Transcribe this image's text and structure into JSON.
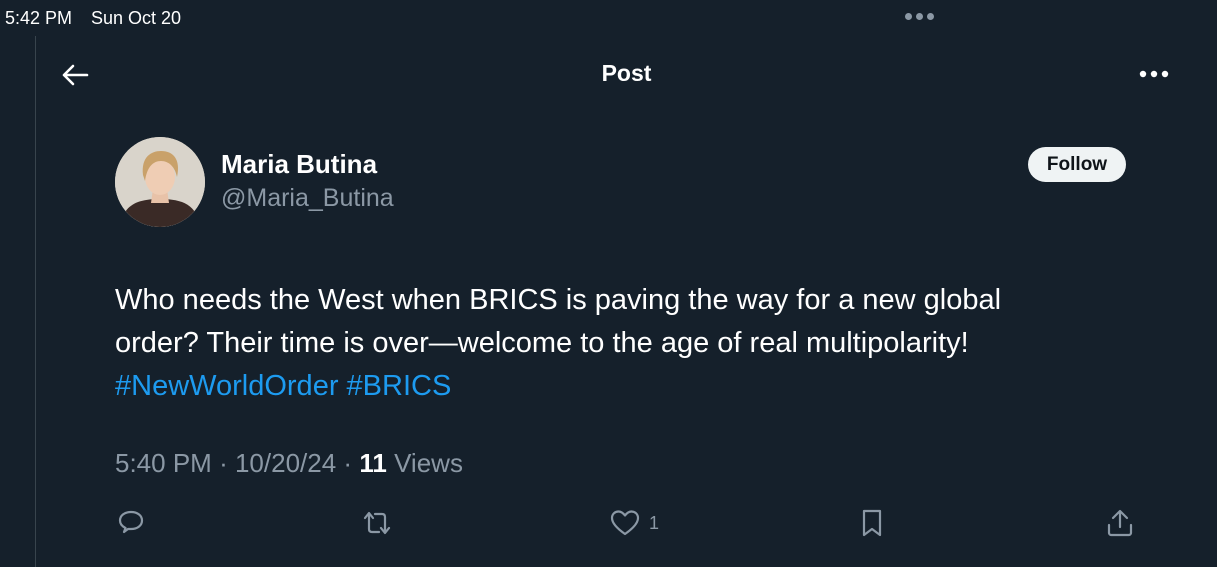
{
  "status_bar": {
    "time": "5:42 PM",
    "date": "Sun Oct 20"
  },
  "header": {
    "title": "Post",
    "back_icon": "arrow-left-icon",
    "more_icon": "more-horizontal-icon"
  },
  "author": {
    "name": "Maria Butina",
    "handle": "@Maria_Butina",
    "follow_label": "Follow"
  },
  "tweet": {
    "text_line_1": "Who needs the West when BRICS is paving the way for a new global",
    "text_line_2": "order? Their time is over—welcome to the age of real multipolarity!",
    "hashtags": [
      "#NewWorldOrder",
      "#BRICS"
    ],
    "time": "5:40 PM",
    "date": "10/20/24",
    "separator": "·",
    "views_count": "11",
    "views_label": "Views"
  },
  "actions": {
    "reply_icon": "reply-icon",
    "repost_icon": "repost-icon",
    "like_icon": "heart-icon",
    "like_count": "1",
    "bookmark_icon": "bookmark-icon",
    "share_icon": "share-icon"
  },
  "colors": {
    "background": "#15202b",
    "link": "#1d9bf0",
    "secondary_text": "#8b98a5",
    "follow_button_bg": "#eff3f4"
  }
}
